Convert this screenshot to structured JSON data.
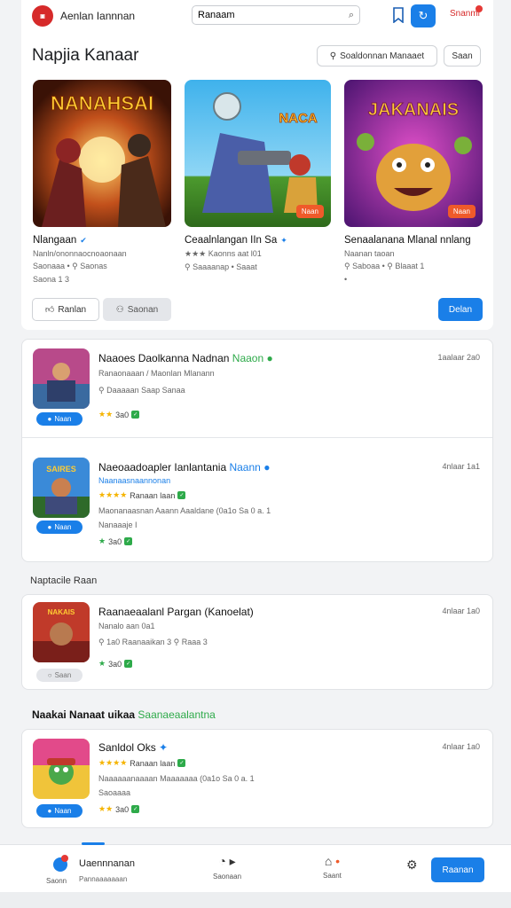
{
  "header": {
    "app_title": "Aenlan Iannnan",
    "search_value": "Ranaam",
    "account_label": "Snanml"
  },
  "featured": {
    "title": "Napjia Kanaar",
    "filter_button": "Soaldonnan Manaaet",
    "sort_button": "Saan",
    "games": [
      {
        "cover_title": "NANAHSAI",
        "name": "Nlangaan",
        "line1": "Nanln/ononnaocnoaonaan",
        "line2": "Saonaaa   •  ⚲ Saonas",
        "line3": "Saona 1 3",
        "badge": ""
      },
      {
        "cover_title": "NACA",
        "name": "Ceaalnlangan IIn Sa",
        "line1": "★★★  Kaonns aat l01",
        "line2": "⚲ Saaaanap    •  Saaat",
        "line3": "",
        "badge": "Naan"
      },
      {
        "cover_title": "JAKANAIS",
        "name": "Senaalanana Mlanal nnlang",
        "line1": "Naanan taoan",
        "line2": "⚲ Saboaa   •  ⚲ Blaaat 1",
        "line3": "•",
        "badge": "Naan"
      }
    ],
    "buttons": {
      "left": "Ranlan",
      "middle": "Saonan",
      "right": "Delan"
    }
  },
  "list1": [
    {
      "title": "Naaoes Daolkanna Nadnan",
      "tag": "Naaon",
      "time": "1aalaar 2a0",
      "line1": "Ranaonaaan / Maonlan Mlanann",
      "line2": "⚲ Daaaaan Saap Sanaa",
      "rating": "3a0",
      "get": "Naan"
    },
    {
      "title": "Naeoaadoapler Ianlantania",
      "tag": "Naann",
      "time": "4nlaar 1a1",
      "line1": "Naanaasnaannonan",
      "line2": "Maonanaasnan Aaann Aaaldane (0a1o Sa 0 a. 1",
      "line3": "Nanaaaje I",
      "rating": "3a0",
      "get": "Naan"
    }
  ],
  "section_heading": "Naptacile Raan",
  "list2": [
    {
      "title": "Raanaeaalanl Pargan (Kanoelat)",
      "time": "4nlaar 1a0",
      "line1": "Nanalo aan 0a1",
      "line2": "⚲ 1a0  Raanaaikan  3      ⚲ Raaa  3",
      "rating": "3a0",
      "get": "Saan"
    }
  ],
  "section_heading2": {
    "main": "Naakai Nanaat uikaa",
    "accent": "Saanaeaalantna"
  },
  "list3": [
    {
      "title": "Sanldol Oks",
      "time": "4nlaar 1a0",
      "line1": "Ranaan laan",
      "line2": "Naaaaaanaaaan Maaaaaaa (0a1o Sa 0 a. 1",
      "line3": "Saoaaaa",
      "rating": "3a0",
      "get": "Naan"
    }
  ],
  "bottom_nav": {
    "user_name": "Uaennnanan",
    "user_label": "Saonn",
    "user_sub": "Pannaaaaaaan",
    "item2": "Saonaan",
    "item3": "Saant",
    "primary": "Raanan"
  },
  "colors": {
    "accent": "#1a7fe8",
    "brand": "#d62a2a",
    "green": "#2eaa4a",
    "star": "#f5b400"
  }
}
